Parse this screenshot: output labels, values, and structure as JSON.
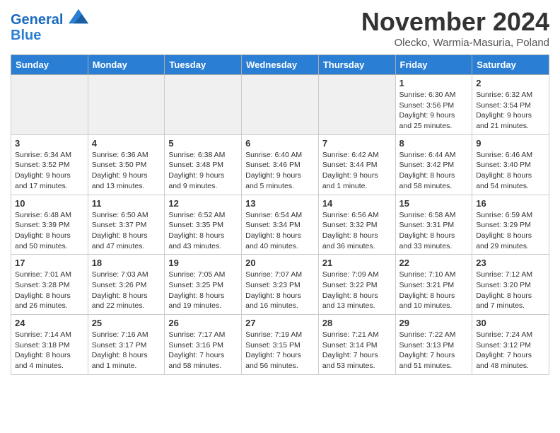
{
  "header": {
    "logo_line1": "General",
    "logo_line2": "Blue",
    "month_title": "November 2024",
    "location": "Olecko, Warmia-Masuria, Poland"
  },
  "weekdays": [
    "Sunday",
    "Monday",
    "Tuesday",
    "Wednesday",
    "Thursday",
    "Friday",
    "Saturday"
  ],
  "weeks": [
    [
      {
        "day": "",
        "info": ""
      },
      {
        "day": "",
        "info": ""
      },
      {
        "day": "",
        "info": ""
      },
      {
        "day": "",
        "info": ""
      },
      {
        "day": "",
        "info": ""
      },
      {
        "day": "1",
        "info": "Sunrise: 6:30 AM\nSunset: 3:56 PM\nDaylight: 9 hours\nand 25 minutes."
      },
      {
        "day": "2",
        "info": "Sunrise: 6:32 AM\nSunset: 3:54 PM\nDaylight: 9 hours\nand 21 minutes."
      }
    ],
    [
      {
        "day": "3",
        "info": "Sunrise: 6:34 AM\nSunset: 3:52 PM\nDaylight: 9 hours\nand 17 minutes."
      },
      {
        "day": "4",
        "info": "Sunrise: 6:36 AM\nSunset: 3:50 PM\nDaylight: 9 hours\nand 13 minutes."
      },
      {
        "day": "5",
        "info": "Sunrise: 6:38 AM\nSunset: 3:48 PM\nDaylight: 9 hours\nand 9 minutes."
      },
      {
        "day": "6",
        "info": "Sunrise: 6:40 AM\nSunset: 3:46 PM\nDaylight: 9 hours\nand 5 minutes."
      },
      {
        "day": "7",
        "info": "Sunrise: 6:42 AM\nSunset: 3:44 PM\nDaylight: 9 hours\nand 1 minute."
      },
      {
        "day": "8",
        "info": "Sunrise: 6:44 AM\nSunset: 3:42 PM\nDaylight: 8 hours\nand 58 minutes."
      },
      {
        "day": "9",
        "info": "Sunrise: 6:46 AM\nSunset: 3:40 PM\nDaylight: 8 hours\nand 54 minutes."
      }
    ],
    [
      {
        "day": "10",
        "info": "Sunrise: 6:48 AM\nSunset: 3:39 PM\nDaylight: 8 hours\nand 50 minutes."
      },
      {
        "day": "11",
        "info": "Sunrise: 6:50 AM\nSunset: 3:37 PM\nDaylight: 8 hours\nand 47 minutes."
      },
      {
        "day": "12",
        "info": "Sunrise: 6:52 AM\nSunset: 3:35 PM\nDaylight: 8 hours\nand 43 minutes."
      },
      {
        "day": "13",
        "info": "Sunrise: 6:54 AM\nSunset: 3:34 PM\nDaylight: 8 hours\nand 40 minutes."
      },
      {
        "day": "14",
        "info": "Sunrise: 6:56 AM\nSunset: 3:32 PM\nDaylight: 8 hours\nand 36 minutes."
      },
      {
        "day": "15",
        "info": "Sunrise: 6:58 AM\nSunset: 3:31 PM\nDaylight: 8 hours\nand 33 minutes."
      },
      {
        "day": "16",
        "info": "Sunrise: 6:59 AM\nSunset: 3:29 PM\nDaylight: 8 hours\nand 29 minutes."
      }
    ],
    [
      {
        "day": "17",
        "info": "Sunrise: 7:01 AM\nSunset: 3:28 PM\nDaylight: 8 hours\nand 26 minutes."
      },
      {
        "day": "18",
        "info": "Sunrise: 7:03 AM\nSunset: 3:26 PM\nDaylight: 8 hours\nand 22 minutes."
      },
      {
        "day": "19",
        "info": "Sunrise: 7:05 AM\nSunset: 3:25 PM\nDaylight: 8 hours\nand 19 minutes."
      },
      {
        "day": "20",
        "info": "Sunrise: 7:07 AM\nSunset: 3:23 PM\nDaylight: 8 hours\nand 16 minutes."
      },
      {
        "day": "21",
        "info": "Sunrise: 7:09 AM\nSunset: 3:22 PM\nDaylight: 8 hours\nand 13 minutes."
      },
      {
        "day": "22",
        "info": "Sunrise: 7:10 AM\nSunset: 3:21 PM\nDaylight: 8 hours\nand 10 minutes."
      },
      {
        "day": "23",
        "info": "Sunrise: 7:12 AM\nSunset: 3:20 PM\nDaylight: 8 hours\nand 7 minutes."
      }
    ],
    [
      {
        "day": "24",
        "info": "Sunrise: 7:14 AM\nSunset: 3:18 PM\nDaylight: 8 hours\nand 4 minutes."
      },
      {
        "day": "25",
        "info": "Sunrise: 7:16 AM\nSunset: 3:17 PM\nDaylight: 8 hours\nand 1 minute."
      },
      {
        "day": "26",
        "info": "Sunrise: 7:17 AM\nSunset: 3:16 PM\nDaylight: 7 hours\nand 58 minutes."
      },
      {
        "day": "27",
        "info": "Sunrise: 7:19 AM\nSunset: 3:15 PM\nDaylight: 7 hours\nand 56 minutes."
      },
      {
        "day": "28",
        "info": "Sunrise: 7:21 AM\nSunset: 3:14 PM\nDaylight: 7 hours\nand 53 minutes."
      },
      {
        "day": "29",
        "info": "Sunrise: 7:22 AM\nSunset: 3:13 PM\nDaylight: 7 hours\nand 51 minutes."
      },
      {
        "day": "30",
        "info": "Sunrise: 7:24 AM\nSunset: 3:12 PM\nDaylight: 7 hours\nand 48 minutes."
      }
    ]
  ]
}
